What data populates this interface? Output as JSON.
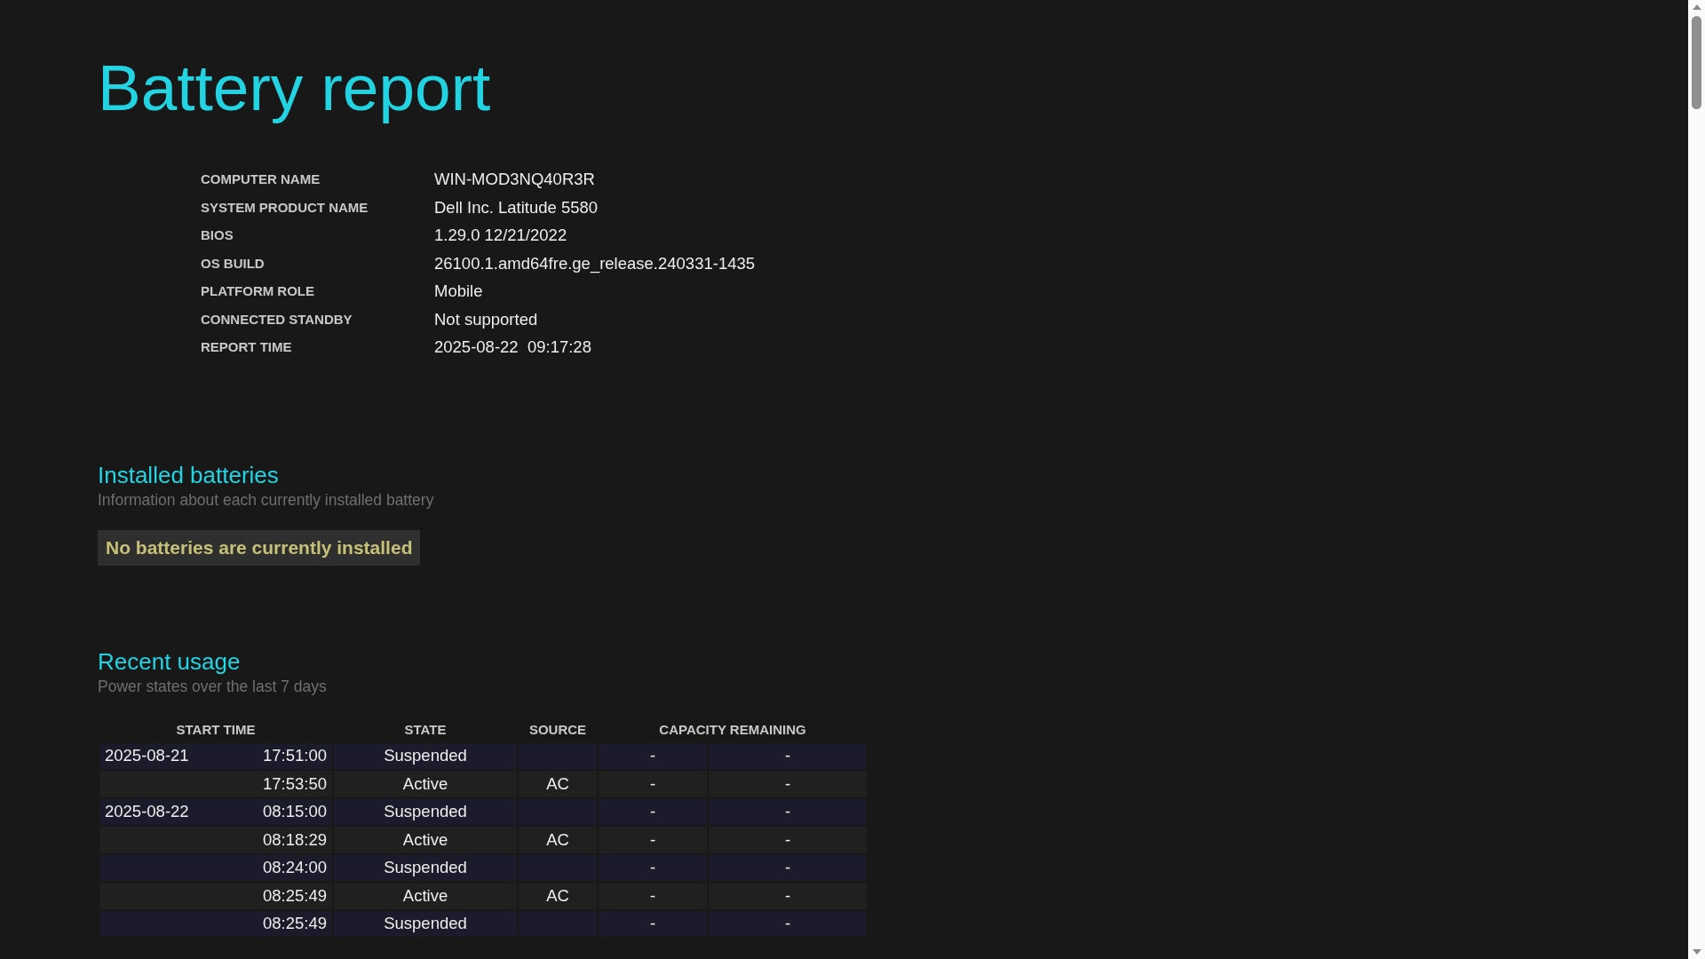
{
  "title": "Battery report",
  "system_info": [
    {
      "label": "COMPUTER NAME",
      "value": "WIN-MOD3NQ40R3R"
    },
    {
      "label": "SYSTEM PRODUCT NAME",
      "value": "Dell Inc. Latitude 5580"
    },
    {
      "label": "BIOS",
      "value": "1.29.0 12/21/2022"
    },
    {
      "label": "OS BUILD",
      "value": "26100.1.amd64fre.ge_release.240331-1435"
    },
    {
      "label": "PLATFORM ROLE",
      "value": "Mobile"
    },
    {
      "label": "CONNECTED STANDBY",
      "value": "Not supported"
    },
    {
      "label": "REPORT TIME",
      "value": "2025-08-22  09:17:28"
    }
  ],
  "installed_batteries": {
    "heading": "Installed batteries",
    "subtitle": "Information about each currently installed battery",
    "notice": "No batteries are currently installed"
  },
  "recent_usage": {
    "heading": "Recent usage",
    "subtitle": "Power states over the last 7 days",
    "columns": [
      "START TIME",
      "STATE",
      "SOURCE",
      "CAPACITY REMAINING"
    ],
    "rows": [
      {
        "date": "2025-08-21",
        "time": "17:51:00",
        "state": "Suspended",
        "capacity_1": "-",
        "capacity_2": "-"
      },
      {
        "time": "17:53:50",
        "state": "Active",
        "source": "AC",
        "capacity_1": "-",
        "capacity_2": "-"
      },
      {
        "date": "2025-08-22",
        "time": "08:15:00",
        "state": "Suspended",
        "capacity_1": "-",
        "capacity_2": "-"
      },
      {
        "time": "08:18:29",
        "state": "Active",
        "source": "AC",
        "capacity_1": "-",
        "capacity_2": "-"
      },
      {
        "time": "08:24:00",
        "state": "Suspended",
        "capacity_1": "-",
        "capacity_2": "-"
      },
      {
        "time": "08:25:49",
        "state": "Active",
        "source": "AC",
        "capacity_1": "-",
        "capacity_2": "-"
      },
      {
        "time": "08:25:49",
        "state": "Suspended",
        "capacity_1": "-",
        "capacity_2": "-"
      }
    ]
  }
}
